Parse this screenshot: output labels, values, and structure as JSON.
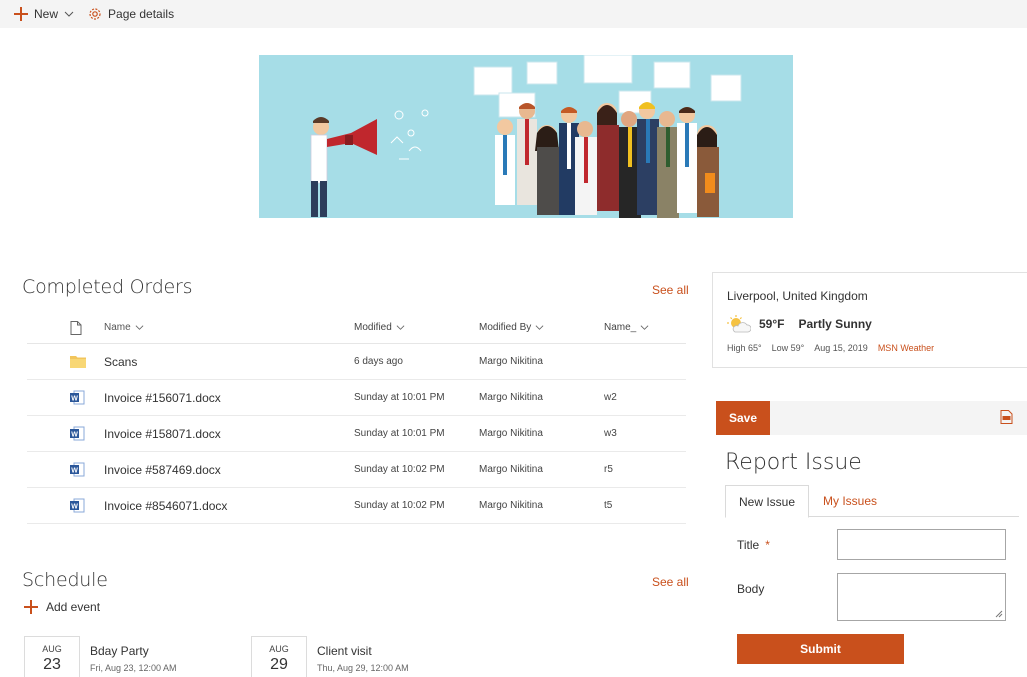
{
  "command_bar": {
    "new_label": "New",
    "page_details_label": "Page details"
  },
  "completed_orders": {
    "title": "Completed Orders",
    "see_all": "See all",
    "columns": {
      "name": "Name",
      "modified": "Modified",
      "modified_by": "Modified By",
      "name2": "Name_"
    },
    "rows": [
      {
        "type": "folder",
        "name": "Scans",
        "modified": "6 days ago",
        "modified_by": "Margo Nikitina",
        "name2": ""
      },
      {
        "type": "docx",
        "name": "Invoice #156071.docx",
        "modified": "Sunday at 10:01 PM",
        "modified_by": "Margo Nikitina",
        "name2": "w2"
      },
      {
        "type": "docx",
        "name": "Invoice #158071.docx",
        "modified": "Sunday at 10:01 PM",
        "modified_by": "Margo Nikitina",
        "name2": "w3"
      },
      {
        "type": "docx",
        "name": "Invoice #587469.docx",
        "modified": "Sunday at 10:02 PM",
        "modified_by": "Margo Nikitina",
        "name2": "r5"
      },
      {
        "type": "docx",
        "name": "Invoice #8546071.docx",
        "modified": "Sunday at 10:02 PM",
        "modified_by": "Margo Nikitina",
        "name2": "t5"
      }
    ]
  },
  "schedule": {
    "title": "Schedule",
    "see_all": "See all",
    "add_event": "Add event",
    "events": [
      {
        "month": "AUG",
        "day": "23",
        "title": "Bday Party",
        "time": "Fri, Aug 23, 12:00 AM"
      },
      {
        "month": "AUG",
        "day": "29",
        "title": "Client visit",
        "time": "Thu, Aug 29, 12:00 AM"
      }
    ]
  },
  "weather": {
    "location": "Liverpool, United Kingdom",
    "temp": "59",
    "unit": "°F",
    "condition": "Partly Sunny",
    "high": "High 65°",
    "low": "Low 59°",
    "date": "Aug 15, 2019",
    "source": "MSN Weather"
  },
  "report_issue": {
    "save_label": "Save",
    "title": "Report Issue",
    "tabs": [
      "New Issue",
      "My Issues"
    ],
    "title_label": "Title",
    "required_mark": "*",
    "body_label": "Body",
    "title_value": "",
    "body_value": "",
    "submit_label": "Submit"
  },
  "colors": {
    "accent": "#c9501c",
    "banner_bg": "#a6dde7"
  }
}
